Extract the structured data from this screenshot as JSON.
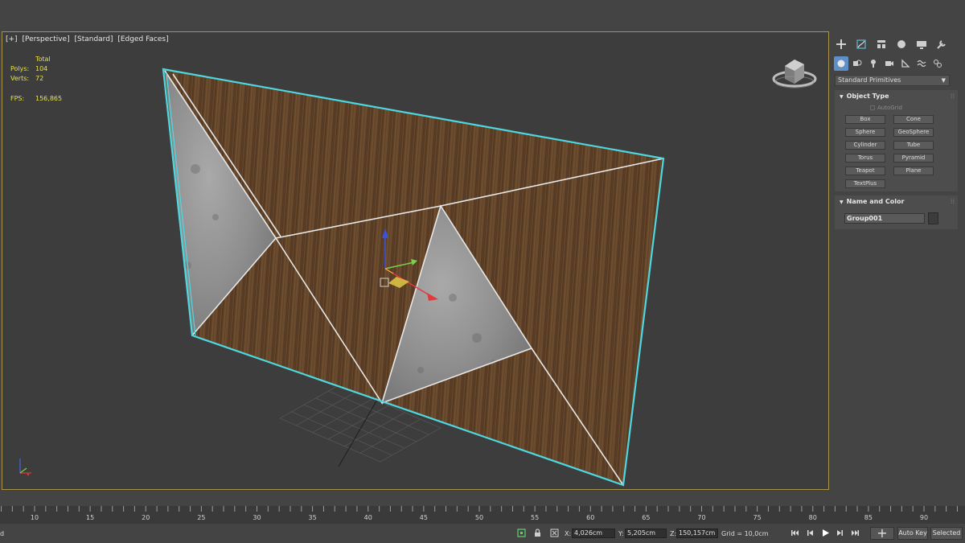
{
  "viewport": {
    "labels": [
      "[+]",
      "[Perspective]",
      "[Standard]",
      "[Edged Faces]"
    ],
    "stats": {
      "total_label": "Total",
      "polys_label": "Polys:",
      "polys_value": "104",
      "verts_label": "Verts:",
      "verts_value": "72",
      "fps_label": "FPS:",
      "fps_value": "156,865"
    }
  },
  "command_panel": {
    "tabs": [
      "create-icon",
      "modify-icon",
      "hierarchy-icon",
      "motion-icon",
      "display-icon",
      "utilities-icon"
    ],
    "subtabs": [
      "geometry-icon",
      "shapes-icon",
      "lights-icon",
      "cameras-icon",
      "helpers-icon",
      "spacewarps-icon",
      "systems-icon"
    ],
    "category_dropdown": "Standard Primitives",
    "object_type": {
      "title": "Object Type",
      "autogrid_label": "AutoGrid",
      "buttons": [
        "Box",
        "Cone",
        "Sphere",
        "GeoSphere",
        "Cylinder",
        "Tube",
        "Torus",
        "Pyramid",
        "Teapot",
        "Plane",
        "TextPlus"
      ]
    },
    "name_and_color": {
      "title": "Name and Color",
      "name_value": "Group001"
    },
    "rollout_dots": "⁞⁞"
  },
  "timeline": {
    "tick_labels": [
      "10",
      "15",
      "20",
      "25",
      "30",
      "35",
      "40",
      "45",
      "50",
      "55",
      "60",
      "65",
      "70",
      "75",
      "80",
      "85",
      "90"
    ]
  },
  "status_bar": {
    "left_text": "d",
    "x_label": "X:",
    "x_value": "4,026cm",
    "y_label": "Y:",
    "y_value": "5,205cm",
    "z_label": "Z:",
    "z_value": "150,157cm",
    "grid_text": "Grid = 10,0cm",
    "auto_key_label": "Auto Key",
    "selected_label": "Selected",
    "set_key_icon": "plus-key-icon"
  },
  "colors": {
    "viewport_border": "#a89348",
    "selection_edge": "#4fd7e0",
    "wood": "#6b4a2e",
    "concrete": "#9a9a9a",
    "stats_text": "#e8e050",
    "active_tab": "#5f8fc7"
  }
}
